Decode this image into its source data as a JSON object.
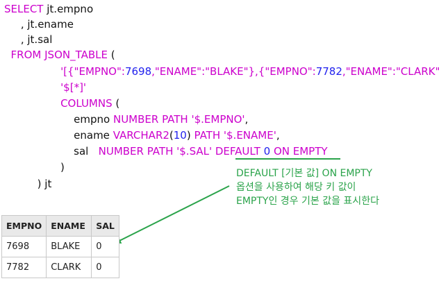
{
  "code": {
    "l1": {
      "kw": "SELECT",
      "rest": " jt.empno"
    },
    "l2": {
      "text": "     , jt.ename"
    },
    "l3": {
      "text": "     , jt.sal"
    },
    "l4": {
      "kw1": "FROM",
      "kw2": " JSON_TABLE",
      "rest": " ("
    },
    "l5": {
      "indent": "                 ",
      "part1": "'[{\"EMPNO\":",
      "n1": "7698",
      "part2": ",\"ENAME\":\"BLAKE\"},{\"EMPNO\":",
      "n2": "7782",
      "part3": ",\"ENAME\":\"CLARK\"}]'",
      "end": ","
    },
    "l6": {
      "indent": "                 ",
      "str": "'$[*]'"
    },
    "l7": {
      "indent": "                 ",
      "kw": "COLUMNS",
      "rest": " ("
    },
    "l8": {
      "indent": "                     ",
      "col": "empno ",
      "type": "NUMBER PATH",
      "path": " '$.EMPNO'",
      "end": ","
    },
    "l9": {
      "indent": "                     ",
      "col": "ename ",
      "type": "VARCHAR2",
      "p1": "(",
      "n": "10",
      "p2": ")",
      "kw": " PATH",
      "path": " '$.ENAME'",
      "end": ","
    },
    "l10": {
      "indent": "                     ",
      "col": "sal   ",
      "type": "NUMBER PATH",
      "path": " '$.SAL'",
      "def1": " DEFAULT ",
      "n": "0",
      "def2": " ON EMPTY"
    },
    "l11": {
      "text": "                 )"
    },
    "l12": {
      "text": "          ) jt"
    }
  },
  "annotation": {
    "line1": "DEFAULT [기본 값] ON EMPTY",
    "line2": "옵션을 사용하여 해당 키 값이",
    "line3": "EMPTY인 경우 기본 값을 표시한다",
    "color": "#2aa34a"
  },
  "result_table": {
    "headers": [
      "EMPNO",
      "ENAME",
      "SAL"
    ],
    "rows": [
      [
        "7698",
        "BLAKE",
        "0"
      ],
      [
        "7782",
        "CLARK",
        "0"
      ]
    ]
  },
  "colors": {
    "keyword": "#cc00cc",
    "number": "#2222ee",
    "annotation": "#2aa34a",
    "header_bg": "#e9e9e9"
  }
}
